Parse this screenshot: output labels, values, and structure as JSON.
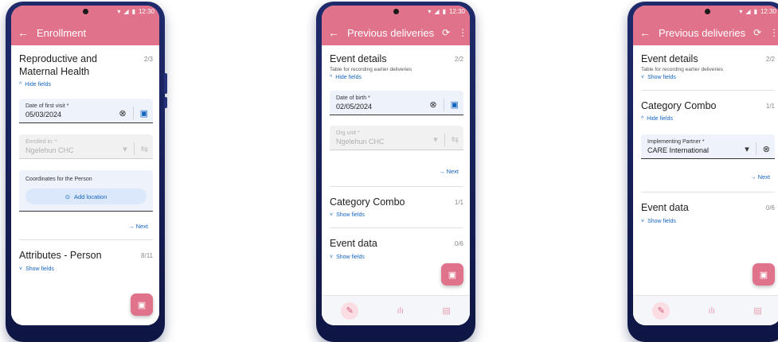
{
  "status": {
    "time": "12:30"
  },
  "phone1": {
    "title": "Enrollment",
    "section1": {
      "title": "Reproductive and Maternal Health",
      "count": "2/3",
      "toggle": "Hide fields"
    },
    "field1": {
      "label": "Date of first visit *",
      "value": "05/03/2024"
    },
    "field2": {
      "label": "Enrolled in: *",
      "value": "Ngelehun CHC"
    },
    "coords": {
      "label": "Coordinates for the Person",
      "button": "Add location"
    },
    "next": "Next",
    "section2": {
      "title": "Attributes - Person",
      "count": "8/11",
      "toggle": "Show fields"
    }
  },
  "phone2": {
    "title": "Previous deliveries",
    "section1": {
      "title": "Event details",
      "subtitle": "Table for recording earlier deliveries",
      "count": "2/2",
      "toggle": "Hide fields"
    },
    "field1": {
      "label": "Date of birth *",
      "value": "02/05/2024"
    },
    "field2": {
      "label": "Org unit *",
      "value": "Ngelehun CHC"
    },
    "next": "Next",
    "section2": {
      "title": "Category Combo",
      "count": "1/1",
      "toggle": "Show fields"
    },
    "section3": {
      "title": "Event data",
      "count": "0/6",
      "toggle": "Show fields"
    }
  },
  "phone3": {
    "title": "Previous deliveries",
    "section1": {
      "title": "Event details",
      "subtitle": "Table for recording earlier deliveries",
      "count": "2/2",
      "toggle": "Show fields"
    },
    "section2": {
      "title": "Category Combo",
      "count": "1/1",
      "toggle": "Hide fields"
    },
    "field1": {
      "label": "Implementing Partner *",
      "value": "CARE International"
    },
    "next": "Next",
    "section3": {
      "title": "Event data",
      "count": "0/6",
      "toggle": "Show fields"
    }
  },
  "icons": {
    "back": "arrow-left-icon",
    "sync": "sync-icon",
    "more": "more-vertical-icon",
    "clear": "clear-circle-icon",
    "calendar": "calendar-icon",
    "save": "save-icon"
  },
  "colors": {
    "primary": "#e0728b",
    "accent": "#1565c0",
    "phone": "#1f2a6b"
  }
}
